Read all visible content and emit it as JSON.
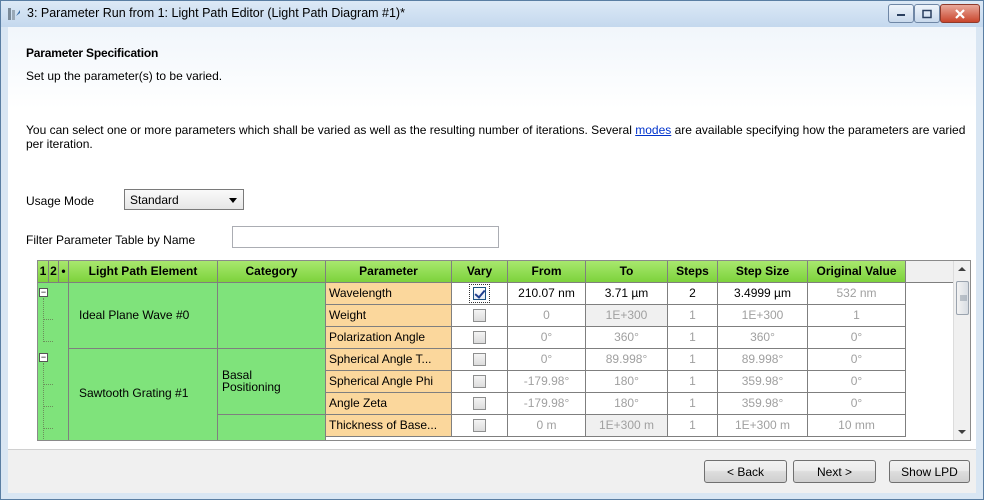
{
  "window": {
    "title": "3: Parameter Run from 1: Light Path Editor (Light Path Diagram #1)*"
  },
  "header": {
    "title": "Parameter Specification",
    "subtitle": "Set up the parameter(s) to be varied."
  },
  "description": {
    "part1": "You can select one or more parameters which shall be varied as well as the resulting number of iterations. Several ",
    "link": "modes",
    "part2": " are available specifying how the parameters are varied per iteration."
  },
  "usage_mode": {
    "label": "Usage Mode",
    "value": "Standard"
  },
  "filter": {
    "label": "Filter Parameter Table by Name",
    "value": ""
  },
  "table": {
    "columns": [
      "1",
      "2",
      "•",
      "Light Path Element",
      "Category",
      "Parameter",
      "Vary",
      "From",
      "To",
      "Steps",
      "Step Size",
      "Original Value"
    ],
    "groups": [
      {
        "element": "Ideal Plane Wave #0",
        "category": ""
      },
      {
        "element": "Sawtooth Grating #1",
        "category": "Basal Positioning"
      }
    ],
    "rows": [
      {
        "parameter": "Wavelength",
        "vary": true,
        "from": "210.07 nm",
        "to": "3.71 µm",
        "steps": "2",
        "step_size": "3.4999 µm",
        "original": "532 nm"
      },
      {
        "parameter": "Weight",
        "vary": false,
        "from": "0",
        "to": "1E+300",
        "steps": "1",
        "step_size": "1E+300",
        "original": "1"
      },
      {
        "parameter": "Polarization Angle",
        "vary": false,
        "from": "0°",
        "to": "360°",
        "steps": "1",
        "step_size": "360°",
        "original": "0°"
      },
      {
        "parameter": "Spherical Angle T...",
        "vary": false,
        "from": "0°",
        "to": "89.998°",
        "steps": "1",
        "step_size": "89.998°",
        "original": "0°"
      },
      {
        "parameter": "Spherical Angle Phi",
        "vary": false,
        "from": "-179.98°",
        "to": "180°",
        "steps": "1",
        "step_size": "359.98°",
        "original": "0°"
      },
      {
        "parameter": "Angle Zeta",
        "vary": false,
        "from": "-179.98°",
        "to": "180°",
        "steps": "1",
        "step_size": "359.98°",
        "original": "0°"
      },
      {
        "parameter": "Thickness of Base...",
        "vary": false,
        "from": "0 m",
        "to": "1E+300 m",
        "steps": "1",
        "step_size": "1E+300 m",
        "original": "10 mm"
      }
    ]
  },
  "footer": {
    "back": "< Back",
    "next": "Next >",
    "show_lpd": "Show LPD"
  },
  "colors": {
    "header_green": "#7dd23c",
    "cell_green": "#7fe37b",
    "param_orange": "#fbd79c",
    "link": "#0033cc"
  }
}
